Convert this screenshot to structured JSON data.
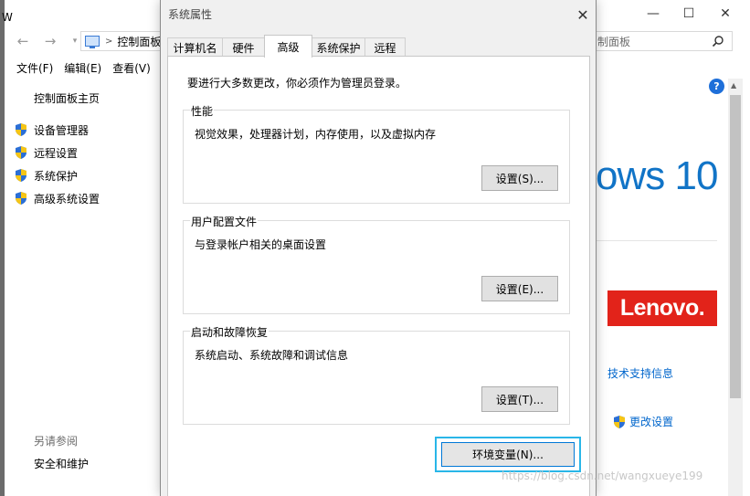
{
  "colors": {
    "accent": "#1174c7",
    "link": "#0066cc",
    "lenovo_red": "#e2231a",
    "focus_highlight": "#29b6e8"
  },
  "bg_window": {
    "title_cut": "W",
    "controls": {
      "min": "—",
      "max": "☐",
      "close": "✕"
    },
    "address": {
      "crumb": "控制面板",
      "search_tail": "制面板"
    },
    "menu": [
      "文件(F)",
      "编辑(E)",
      "查看(V)"
    ],
    "left_pane": {
      "home": "控制面板主页",
      "links": [
        "设备管理器",
        "远程设置",
        "系统保护",
        "高级系统设置"
      ],
      "see_also_heading": "另请参阅",
      "see_also_link": "安全和维护"
    },
    "right_pane": {
      "help_icon": "?",
      "os_brand_fragment": "ows 10",
      "oem_logo": "Lenovo.",
      "tech_support": "技术支持信息",
      "change_settings": "更改设置"
    }
  },
  "dialog": {
    "title": "系统属性",
    "close": "✕",
    "tabs": [
      {
        "label": "计算机名",
        "active": false
      },
      {
        "label": "硬件",
        "active": false
      },
      {
        "label": "高级",
        "active": true
      },
      {
        "label": "系统保护",
        "active": false
      },
      {
        "label": "远程",
        "active": false
      }
    ],
    "admin_note": "要进行大多数更改，你必须作为管理员登录。",
    "groups": [
      {
        "title": "性能",
        "description": "视觉效果，处理器计划，内存使用，以及虚拟内存",
        "button": "设置(S)..."
      },
      {
        "title": "用户配置文件",
        "description": "与登录帐户相关的桌面设置",
        "button": "设置(E)..."
      },
      {
        "title": "启动和故障恢复",
        "description": "系统启动、系统故障和调试信息",
        "button": "设置(T)..."
      }
    ],
    "env_button": "环境变量(N)..."
  },
  "watermark": "https://blog.csdn.net/wangxueye199"
}
